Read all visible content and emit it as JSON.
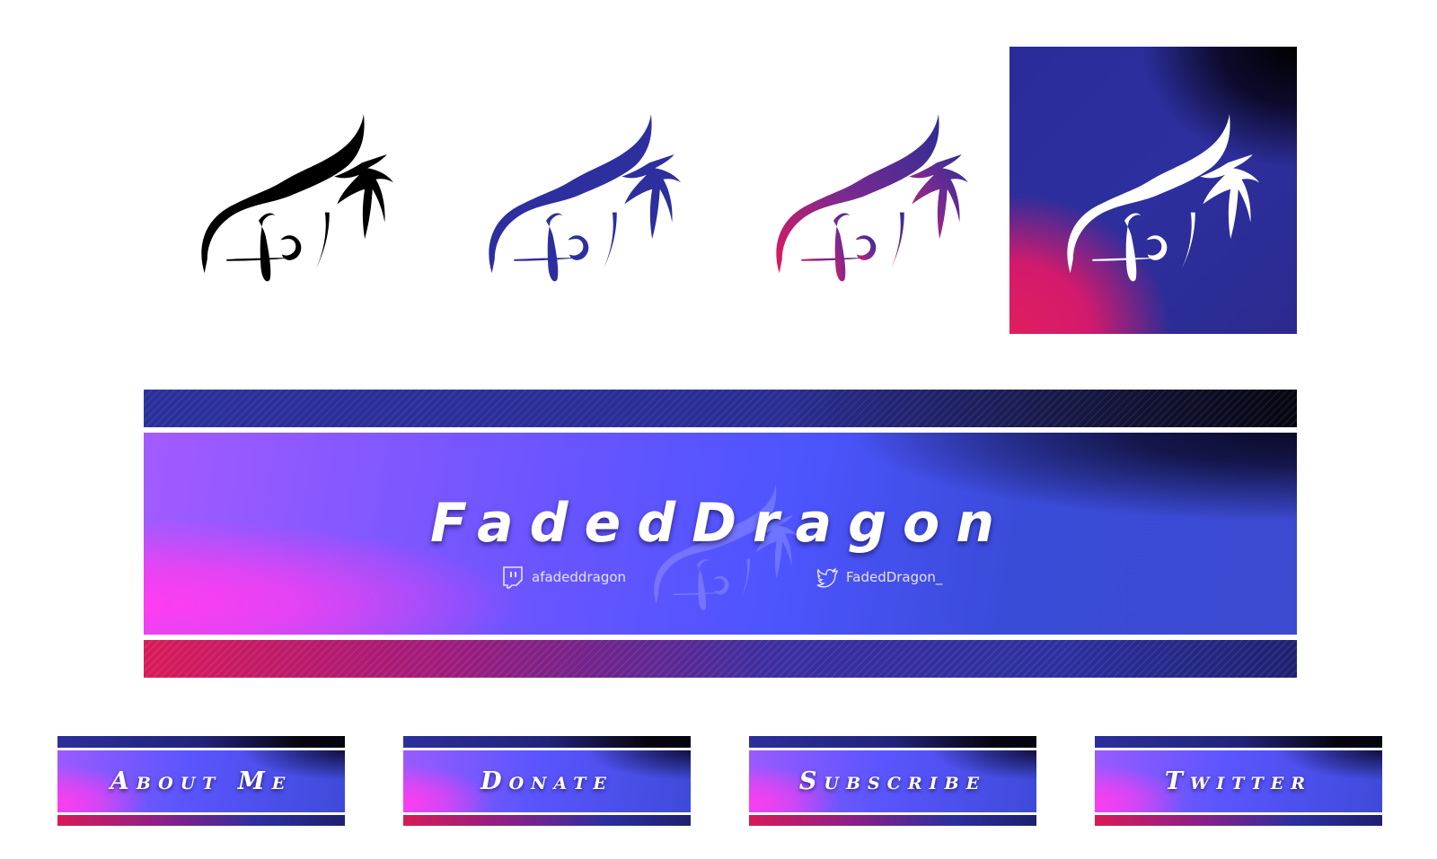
{
  "colors": {
    "black": "#000000",
    "indigo": "#2d2f9e",
    "pink": "#e0195e",
    "magenta": "#ff3cf0",
    "white": "#ffffff"
  },
  "logo_variants": [
    {
      "style": "black-outline"
    },
    {
      "style": "indigo-outline"
    },
    {
      "style": "pink-indigo-gradient-outline"
    },
    {
      "style": "white-on-gradient"
    }
  ],
  "banner": {
    "title": "FadedDragon",
    "twitch_handle": "afadeddragon",
    "twitter_handle": "FadedDragon_",
    "twitch_icon": "twitch-icon",
    "twitter_icon": "twitter-bird-icon"
  },
  "panels": [
    {
      "label": "About Me"
    },
    {
      "label": "Donate"
    },
    {
      "label": "Subscribe"
    },
    {
      "label": "Twitter"
    }
  ]
}
